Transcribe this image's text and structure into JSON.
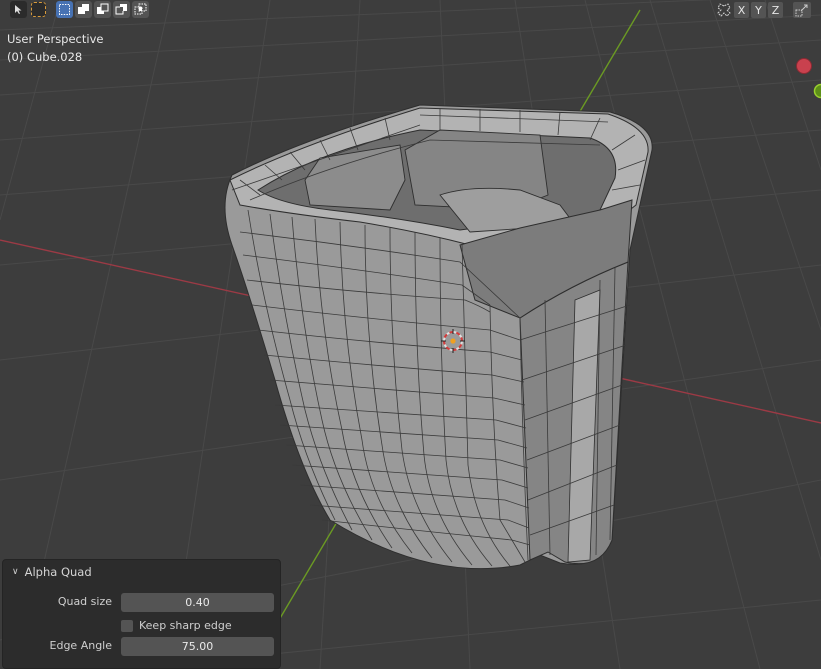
{
  "viewport": {
    "view_name": "User Perspective",
    "object_info": "(0) Cube.028"
  },
  "header_tools": {
    "select_tool_icon": "cursor-arrow-icon",
    "modes": [
      "select-box-icon",
      "extend-icon",
      "subtract-icon",
      "invert-icon",
      "intersect-icon"
    ]
  },
  "mirror_axes": {
    "icon": "butterfly-mirror-icon",
    "x": "X",
    "y": "Y",
    "z": "Z",
    "gizmo_icon": "transform-gizmo-icon"
  },
  "operator_panel": {
    "title": "Alpha Quad",
    "quad_size_label": "Quad size",
    "quad_size_value": "0.40",
    "keep_sharp_label": "Keep sharp edge",
    "keep_sharp_checked": false,
    "edge_angle_label": "Edge Angle",
    "edge_angle_value": "75.00"
  },
  "colors": {
    "background": "#3d3d3d",
    "grid": "#4a4a4a",
    "x_axis": "#9c3a45",
    "y_axis": "#6b9a23",
    "mesh_face": "#9b9b9b",
    "mesh_edge": "#2e2e2e",
    "accent": "#4772b3"
  }
}
